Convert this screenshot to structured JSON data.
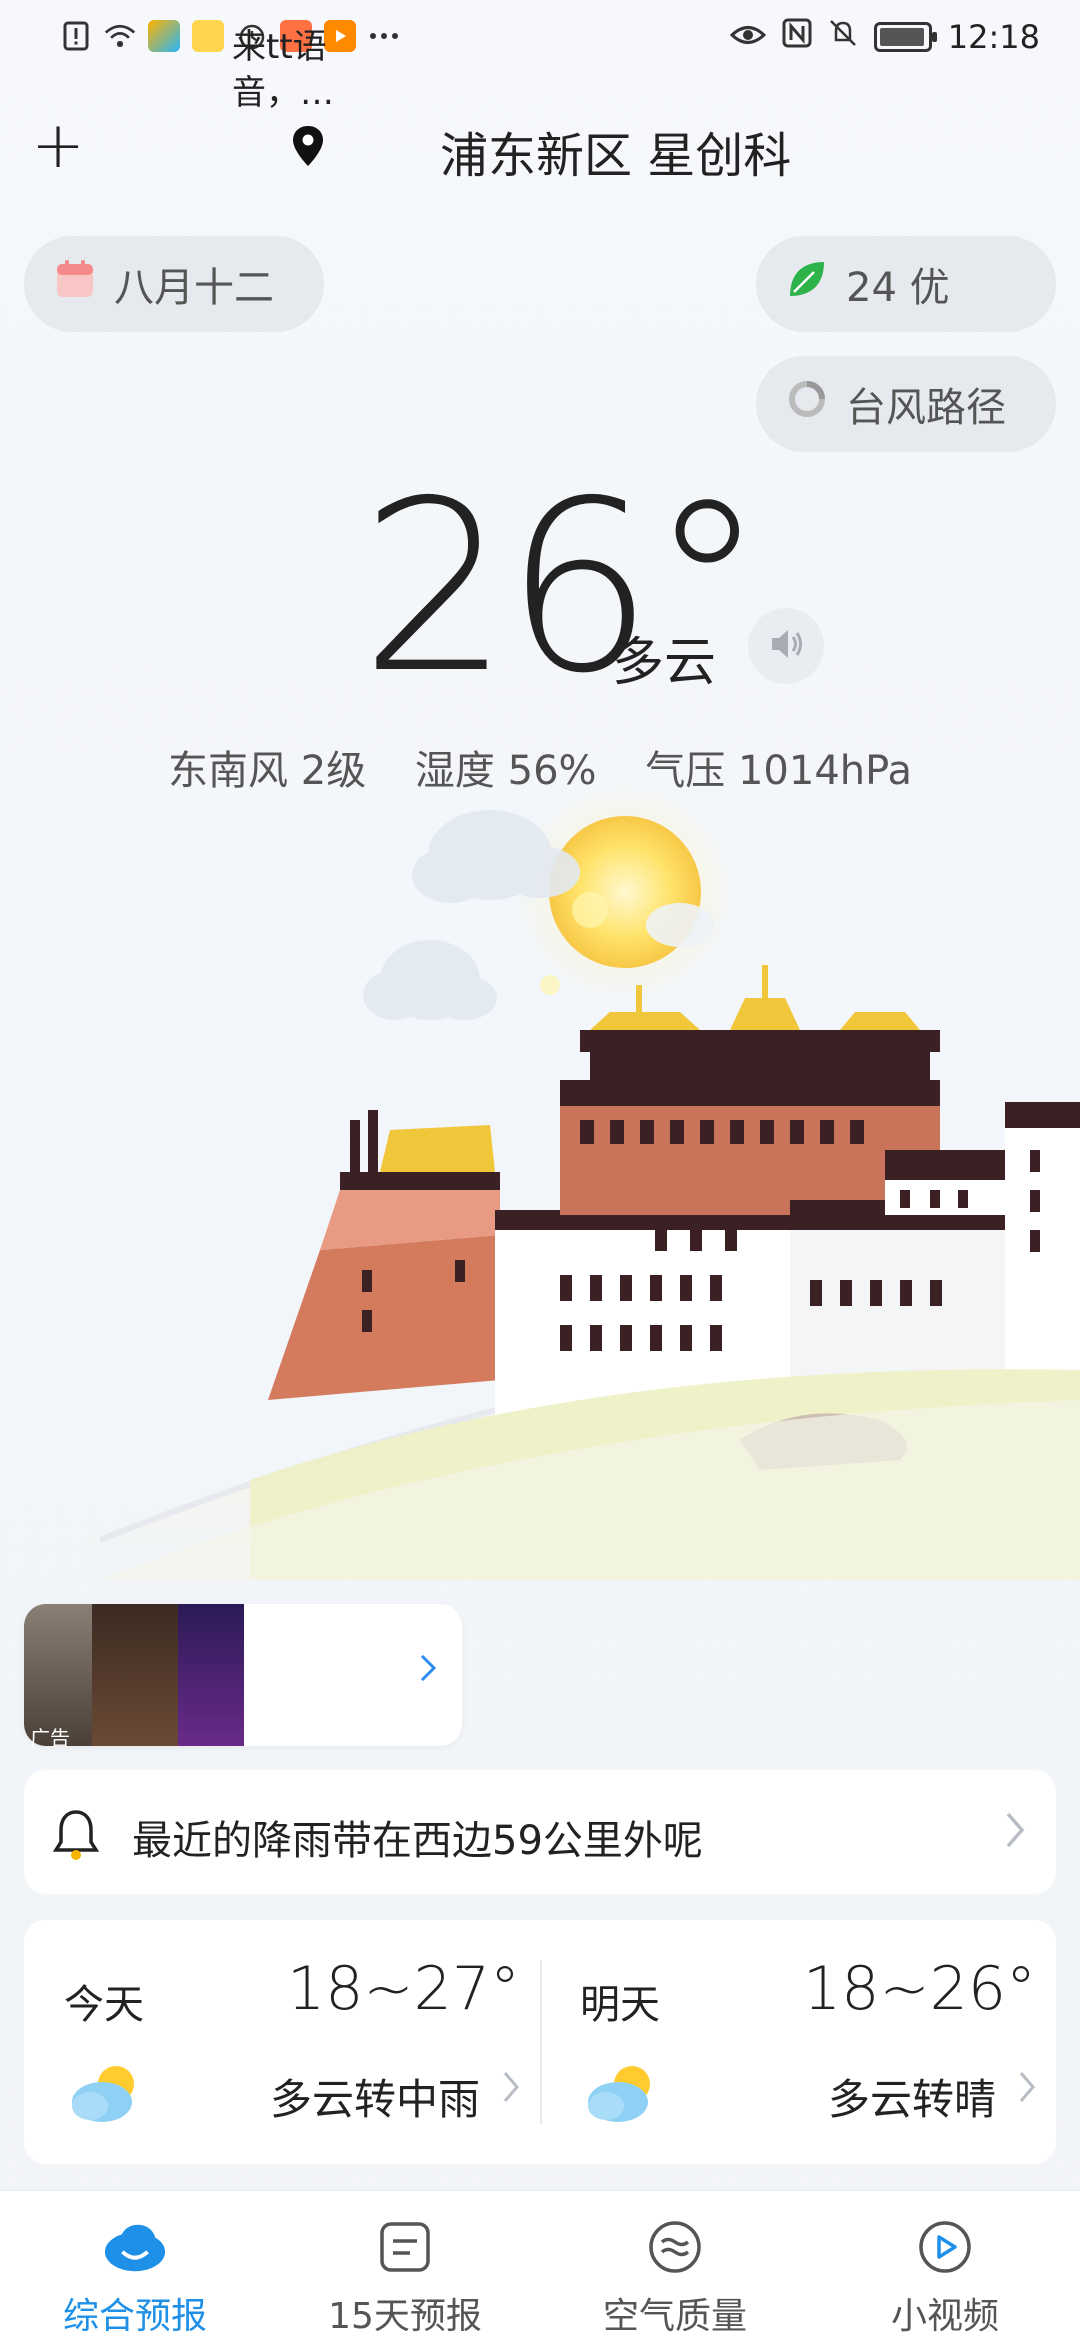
{
  "status_bar": {
    "time": "12:18"
  },
  "header": {
    "add_label": "+",
    "location": "浦东新区 星创科"
  },
  "pills": {
    "lunar_date": "八月十二",
    "aqi": "24 优",
    "typhoon": "台风路径"
  },
  "current": {
    "temperature": "26°",
    "condition": "多云",
    "wind": "东南风 2级",
    "humidity": "湿度 56%",
    "pressure": "气压 1014hPa"
  },
  "ad": {
    "text": "来tt语音，…",
    "tag": "广告"
  },
  "rain_alert": {
    "text": "最近的降雨带在西边59公里外呢"
  },
  "forecast": {
    "today": {
      "label": "今天",
      "range": "18~27°",
      "condition": "多云转中雨"
    },
    "tomorrow": {
      "label": "明天",
      "range": "18~26°",
      "condition": "多云转晴"
    }
  },
  "nav": {
    "items": [
      {
        "label": "综合预报",
        "icon": "cloud-icon",
        "active": true
      },
      {
        "label": "15天预报",
        "icon": "list-icon",
        "active": false
      },
      {
        "label": "空气质量",
        "icon": "wind-icon",
        "active": false
      },
      {
        "label": "小视频",
        "icon": "play-icon",
        "active": false
      }
    ]
  },
  "colors": {
    "accent": "#1e90e8",
    "aqi_leaf": "#2db34a",
    "pill_bg": "#e6e9ee"
  }
}
